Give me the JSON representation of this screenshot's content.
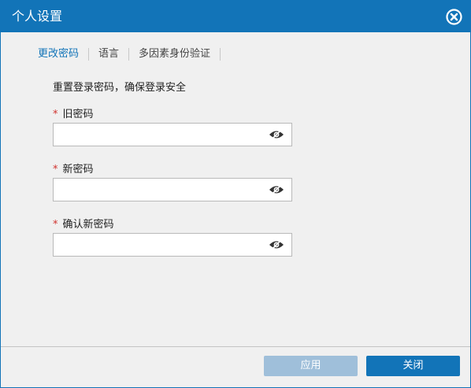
{
  "dialog": {
    "title": "个人设置",
    "close_icon": "close-circle-icon"
  },
  "tabs": [
    {
      "label": "更改密码",
      "active": true
    },
    {
      "label": "语言",
      "active": false
    },
    {
      "label": "多因素身份验证",
      "active": false
    }
  ],
  "form": {
    "subtitle": "重置登录密码，确保登录安全",
    "required_mark": "*",
    "fields": [
      {
        "label": "旧密码",
        "value": "",
        "icon": "eye-hidden-icon"
      },
      {
        "label": "新密码",
        "value": "",
        "icon": "eye-hidden-icon"
      },
      {
        "label": "确认新密码",
        "value": "",
        "icon": "eye-hidden-icon"
      }
    ]
  },
  "footer": {
    "apply_label": "应用",
    "close_label": "关闭"
  },
  "colors": {
    "accent": "#1274b8",
    "disabled_button": "#9fbfda",
    "required": "#d0312d",
    "background": "#f0f0f0"
  }
}
